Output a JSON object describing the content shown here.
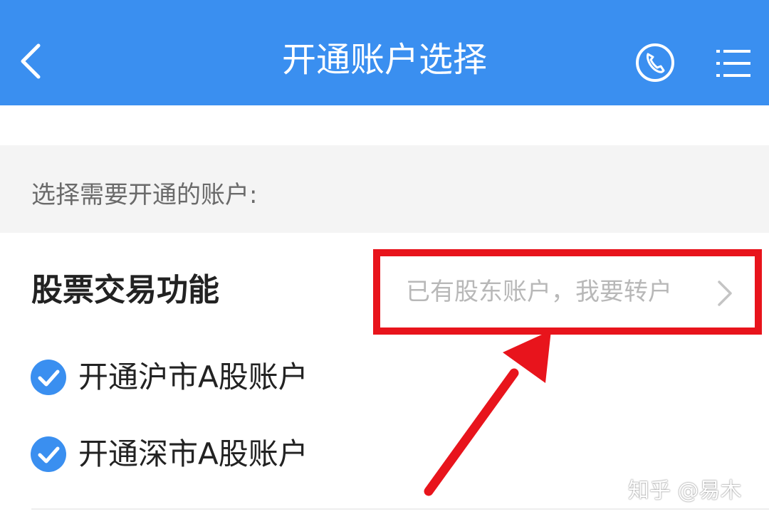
{
  "header": {
    "title": "开通账户选择",
    "back_icon": "chevron-left-icon",
    "call_icon": "phone-icon",
    "menu_icon": "list-menu-icon",
    "background_color": "#3a8ff0"
  },
  "prompt": "选择需要开通的账户:",
  "section": {
    "title": "股票交易功能",
    "transfer_link": "已有股东账户，我要转户",
    "transfer_icon": "chevron-right-icon"
  },
  "options": [
    {
      "label": "开通沪市A股账户",
      "checked": true
    },
    {
      "label": "开通深市A股账户",
      "checked": true
    }
  ],
  "annotation": {
    "highlight_color": "#e8141c",
    "arrow_icon": "red-arrow-icon"
  },
  "watermark": "知乎 @易木"
}
